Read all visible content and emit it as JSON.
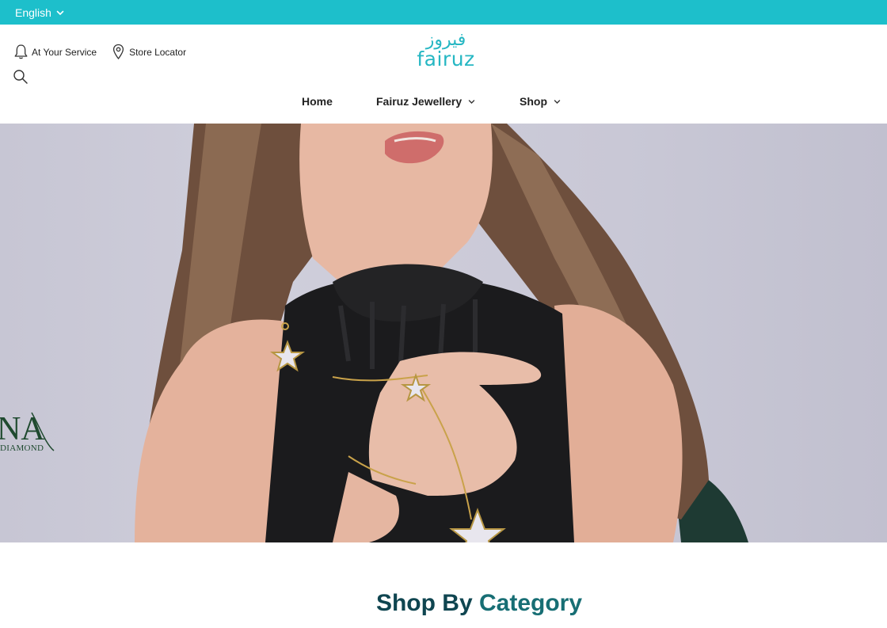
{
  "topbar": {
    "language": "English"
  },
  "utility": {
    "service_label": "At Your Service",
    "store_label": "Store Locator"
  },
  "logo": {
    "arabic": "فيروز",
    "english": "fairuz"
  },
  "nav": {
    "home": "Home",
    "jewellery": "Fairuz Jewellery",
    "shop": "Shop"
  },
  "hero": {
    "brand_word": "DIAMOND",
    "brand_letters": "NA"
  },
  "section": {
    "title_part1": "Shop By",
    "title_part2": "Category"
  },
  "colors": {
    "topbar": "#1dbfcb",
    "logo": "#26b7c3",
    "title": "#0f4550"
  },
  "icons": [
    "chevron-down-icon",
    "bell-icon",
    "location-pin-icon",
    "search-icon"
  ]
}
